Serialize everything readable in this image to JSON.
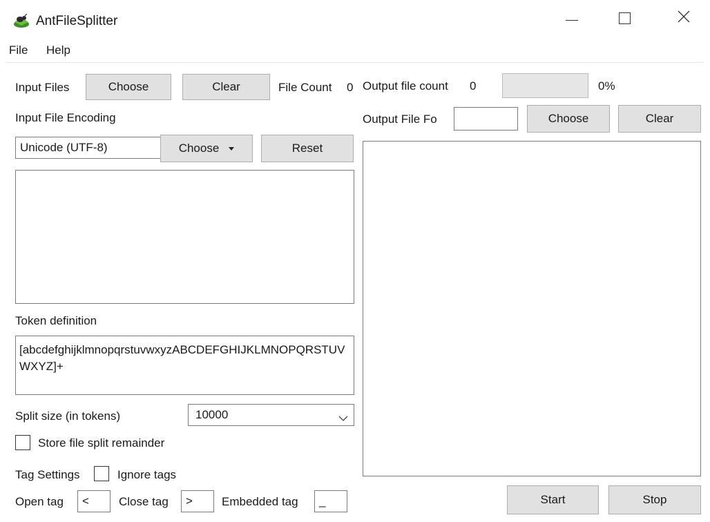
{
  "window": {
    "title": "AntFileSplitter",
    "icon": "ant-app-icon",
    "controls": [
      "minimize-icon",
      "maximize-icon",
      "close-icon"
    ]
  },
  "menu": {
    "file": "File",
    "help": "Help"
  },
  "left": {
    "input_files_label": "Input Files",
    "choose_label": "Choose",
    "clear_label": "Clear",
    "file_count_label": "File Count",
    "file_count_value": "0",
    "encoding_label": "Input File Encoding",
    "encoding_value": "Unicode (UTF-8)",
    "encoding_choose_label": "Choose",
    "reset_label": "Reset",
    "token_definition_label": "Token definition",
    "token_definition_value": "[abcdefghijklmnopqrstuvwxyzABCDEFGHIJKLMNOPQRSTUVWXYZ]+",
    "split_size_label": "Split size (in tokens)",
    "split_size_value": "10000",
    "store_remainder_label": "Store file split remainder",
    "store_remainder_checked": false,
    "tag_settings_label": "Tag Settings",
    "ignore_tags_label": "Ignore tags",
    "ignore_tags_checked": false,
    "open_tag_label": "Open tag",
    "open_tag_value": "<",
    "close_tag_label": "Close tag",
    "close_tag_value": ">",
    "embedded_tag_label": "Embedded tag",
    "embedded_tag_value": "_"
  },
  "right": {
    "output_file_count_label": "Output file count",
    "output_file_count_value": "0",
    "progress_percent": 0,
    "progress_text": "0%",
    "output_folder_label": "Output File Fo",
    "output_folder_value": "",
    "choose_label": "Choose",
    "clear_label": "Clear",
    "start_label": "Start",
    "stop_label": "Stop"
  }
}
